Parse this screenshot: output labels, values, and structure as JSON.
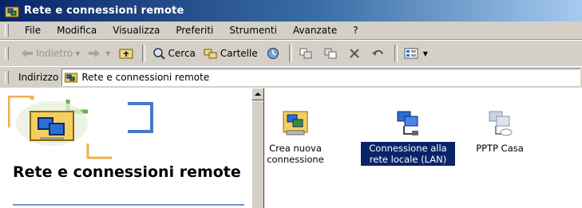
{
  "window": {
    "title": "Rete e connessioni remote"
  },
  "menu": [
    "File",
    "Modifica",
    "Visualizza",
    "Preferiti",
    "Strumenti",
    "Avanzate",
    "?"
  ],
  "toolbar": {
    "back": "Indietro",
    "search": "Cerca",
    "folders": "Cartelle"
  },
  "address": {
    "label": "Indirizzo",
    "value": "Rete e connessioni remote"
  },
  "left_pane": {
    "title": "Rete e connessioni remote"
  },
  "items": [
    {
      "label": "Crea nuova connessione",
      "selected": false,
      "icon": "new-connection-icon"
    },
    {
      "label": "Connessione alla rete locale (LAN)",
      "selected": true,
      "icon": "lan-connection-icon"
    },
    {
      "label": "PPTP Casa",
      "selected": false,
      "icon": "vpn-connection-icon"
    }
  ],
  "colors": {
    "title_start": "#0a246a",
    "title_end": "#a6caf0",
    "selection": "#0a246a",
    "chrome": "#d4d0c8"
  }
}
